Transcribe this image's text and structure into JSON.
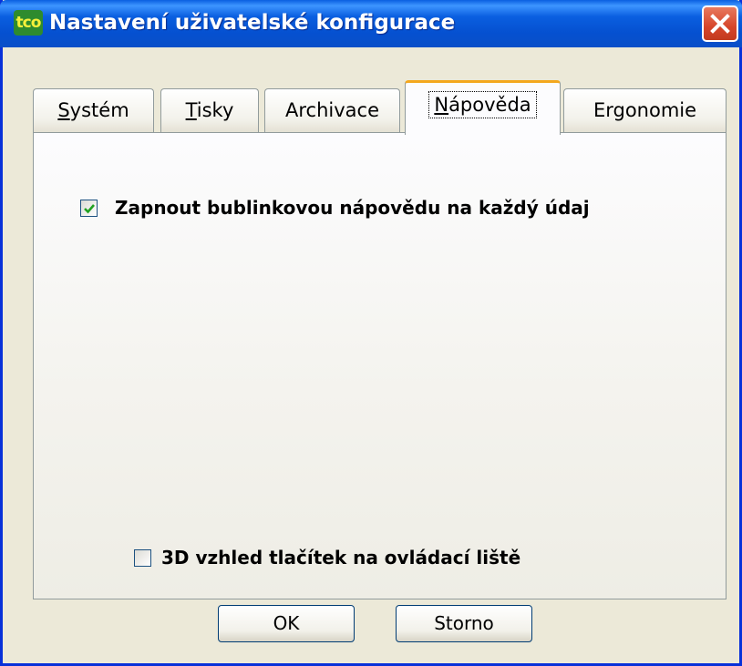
{
  "window": {
    "app_icon_text": "tco",
    "title": "Nastavení uživatelské konfigurace",
    "close_label": "Close"
  },
  "tabs": [
    {
      "label": "Systém",
      "accesskey": "S",
      "rest": "ystém",
      "active": false
    },
    {
      "label": "Tisky",
      "accesskey": "T",
      "rest": "isky",
      "active": false
    },
    {
      "label": "Archivace",
      "accesskey": "",
      "rest": "Archivace",
      "active": false
    },
    {
      "label": "Nápověda",
      "accesskey": "N",
      "rest": "ápověda",
      "active": true
    },
    {
      "label": "Ergonomie",
      "accesskey": "",
      "rest": "Ergonomie",
      "active": false
    }
  ],
  "options": {
    "bubble_help": {
      "label": "Zapnout bublinkovou nápovědu na každý údaj",
      "checked": true
    },
    "toolbar_3d": {
      "label": "3D vzhled tlačítek na ovládací liště",
      "checked": false
    }
  },
  "buttons": {
    "ok": "OK",
    "cancel": "Storno"
  },
  "colors": {
    "titlebar": "#0A5FE0",
    "active_tab_accent": "#F4A81E",
    "checkmark": "#21A121",
    "close_button": "#D6452A"
  }
}
